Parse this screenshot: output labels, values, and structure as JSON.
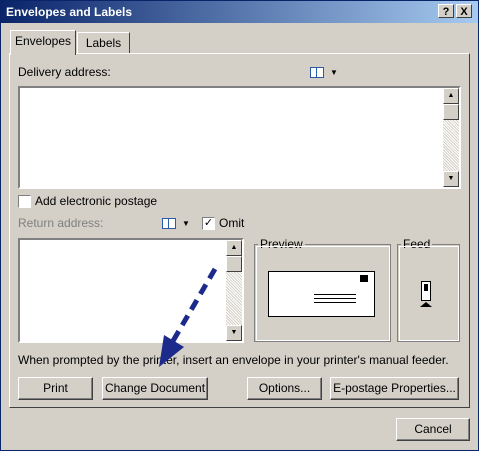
{
  "window": {
    "title": "Envelopes and Labels",
    "help_btn": "?",
    "close_btn": "X"
  },
  "tabs": [
    {
      "label": "Envelopes"
    },
    {
      "label": "Labels"
    }
  ],
  "delivery": {
    "label": "Delivery address:",
    "value": ""
  },
  "postage": {
    "label": "Add electronic postage",
    "checked": false
  },
  "return": {
    "label": "Return address:",
    "omit_label": "Omit",
    "omit_checked": true,
    "value": ""
  },
  "preview": {
    "label": "Preview"
  },
  "feed": {
    "label": "Feed"
  },
  "message": "When prompted by the printer, insert an envelope in your printer's manual feeder.",
  "buttons": {
    "print": "Print",
    "change_document": "Change Document",
    "options": "Options...",
    "epostage": "E-postage Properties...",
    "cancel": "Cancel"
  },
  "icons": {
    "address_book": "address-book-icon",
    "dropdown": "chevron-down-icon"
  },
  "colors": {
    "title_start": "#0a246a",
    "title_end": "#a6caf0",
    "face": "#d4d0c8",
    "arrow": "#1c2a8c"
  }
}
